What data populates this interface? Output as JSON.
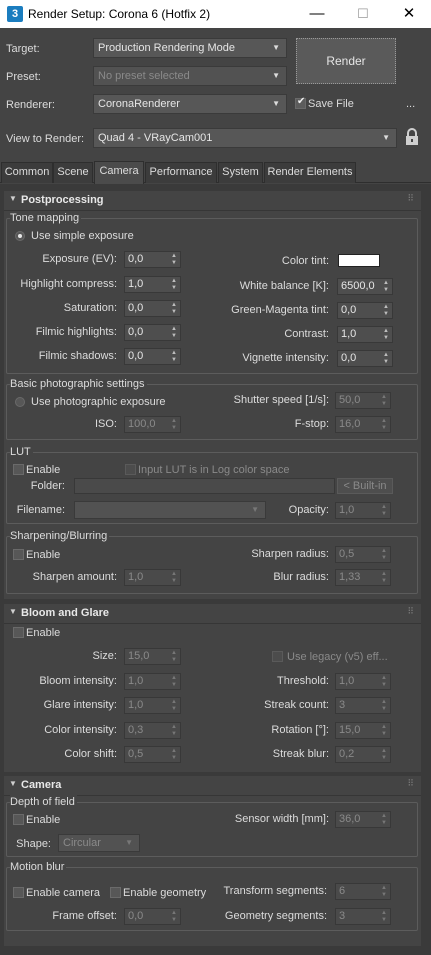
{
  "window": {
    "app_icon": "3",
    "title": "Render Setup: Corona 6 (Hotfix 2)",
    "minimize": "—",
    "maximize": "☐",
    "close": "✕"
  },
  "header": {
    "target_label": "Target:",
    "target_value": "Production Rendering Mode",
    "preset_label": "Preset:",
    "preset_value": "No preset selected",
    "renderer_label": "Renderer:",
    "renderer_value": "CoronaRenderer",
    "save_file_label": "Save File",
    "save_file_checked": true,
    "more_label": "...",
    "view_label": "View to Render:",
    "view_value": "Quad 4 - VRayCam001",
    "render_button": "Render",
    "lock_icon": "lock-icon"
  },
  "tabs": [
    {
      "label": "Common",
      "active": false
    },
    {
      "label": "Scene",
      "active": false
    },
    {
      "label": "Camera",
      "active": true
    },
    {
      "label": "Performance",
      "active": false
    },
    {
      "label": "System",
      "active": false
    },
    {
      "label": "Render Elements",
      "active": false
    }
  ],
  "postprocessing": {
    "title": "Postprocessing",
    "tone_mapping": {
      "group_label": "Tone mapping",
      "use_simple_exposure": "Use simple exposure",
      "exposure_label": "Exposure (EV):",
      "exposure_value": "0,0",
      "highlight_label": "Highlight compress:",
      "highlight_value": "1,0",
      "saturation_label": "Saturation:",
      "saturation_value": "0,0",
      "filmic_highlights_label": "Filmic highlights:",
      "filmic_highlights_value": "0,0",
      "filmic_shadows_label": "Filmic shadows:",
      "filmic_shadows_value": "0,0",
      "color_tint_label": "Color tint:",
      "color_tint_color": "#ffffff",
      "white_balance_label": "White balance [K]:",
      "white_balance_value": "6500,0",
      "green_magenta_label": "Green-Magenta tint:",
      "green_magenta_value": "0,0",
      "contrast_label": "Contrast:",
      "contrast_value": "1,0",
      "vignette_label": "Vignette intensity:",
      "vignette_value": "0,0"
    },
    "basic_photo": {
      "group_label": "Basic photographic settings",
      "use_photographic": "Use photographic exposure",
      "shutter_label": "Shutter speed [1/s]:",
      "shutter_value": "50,0",
      "iso_label": "ISO:",
      "iso_value": "100,0",
      "fstop_label": "F-stop:",
      "fstop_value": "16,0"
    },
    "lut": {
      "group_label": "LUT",
      "enable": "Enable",
      "input_log": "Input LUT is in Log color space",
      "folder_label": "Folder:",
      "builtin_button": "< Built-in",
      "filename_label": "Filename:",
      "opacity_label": "Opacity:",
      "opacity_value": "1,0"
    },
    "sharpening": {
      "group_label": "Sharpening/Blurring",
      "enable": "Enable",
      "sharpen_radius_label": "Sharpen radius:",
      "sharpen_radius_value": "0,5",
      "sharpen_amount_label": "Sharpen amount:",
      "sharpen_amount_value": "1,0",
      "blur_radius_label": "Blur radius:",
      "blur_radius_value": "1,33"
    }
  },
  "bloom": {
    "title": "Bloom and Glare",
    "enable": "Enable",
    "size_label": "Size:",
    "size_value": "15,0",
    "use_legacy": "Use legacy (v5) eff...",
    "bloom_intensity_label": "Bloom intensity:",
    "bloom_intensity_value": "1,0",
    "threshold_label": "Threshold:",
    "threshold_value": "1,0",
    "glare_intensity_label": "Glare intensity:",
    "glare_intensity_value": "1,0",
    "streak_count_label": "Streak count:",
    "streak_count_value": "3",
    "color_intensity_label": "Color intensity:",
    "color_intensity_value": "0,3",
    "rotation_label": "Rotation [°]:",
    "rotation_value": "15,0",
    "color_shift_label": "Color shift:",
    "color_shift_value": "0,5",
    "streak_blur_label": "Streak blur:",
    "streak_blur_value": "0,2"
  },
  "camera": {
    "title": "Camera",
    "dof_group_label": "Depth of field",
    "dof_enable": "Enable",
    "sensor_width_label": "Sensor width [mm]:",
    "sensor_width_value": "36,0",
    "shape_label": "Shape:",
    "shape_value": "Circular",
    "motion_group_label": "Motion blur",
    "enable_camera": "Enable camera",
    "enable_geometry": "Enable geometry",
    "transform_segments_label": "Transform segments:",
    "transform_segments_value": "6",
    "frame_offset_label": "Frame offset:",
    "frame_offset_value": "0,0",
    "geometry_segments_label": "Geometry segments:",
    "geometry_segments_value": "3"
  }
}
